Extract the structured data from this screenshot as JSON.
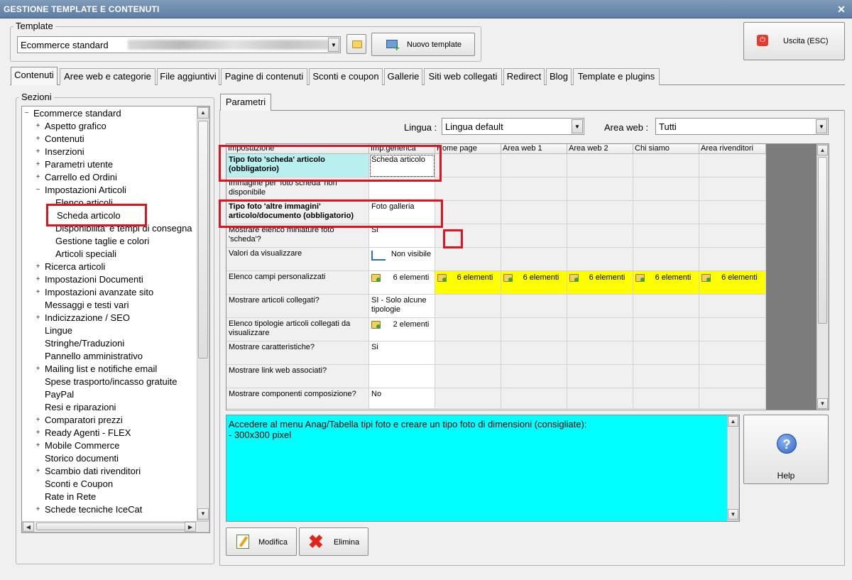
{
  "window": {
    "title": "GESTIONE TEMPLATE E CONTENUTI"
  },
  "template_group": {
    "label": "Template",
    "selected": "Ecommerce standard",
    "new_button": "Nuovo template"
  },
  "exit_button": "Uscita (ESC)",
  "tabs": [
    "Contenuti",
    "Aree web e categorie",
    "File aggiuntivi",
    "Pagine di contenuti",
    "Sconti e coupon",
    "Gallerie",
    "Siti web collegati",
    "Redirect",
    "Blog",
    "Template e plugins"
  ],
  "sections": {
    "label": "Sezioni",
    "tree": [
      {
        "label": "Ecommerce standard",
        "level": 0,
        "exp": "minus"
      },
      {
        "label": "Aspetto grafico",
        "level": 1,
        "exp": "plus"
      },
      {
        "label": "Contenuti",
        "level": 1,
        "exp": "plus"
      },
      {
        "label": "Inserzioni",
        "level": 1,
        "exp": "plus"
      },
      {
        "label": "Parametri utente",
        "level": 1,
        "exp": "plus"
      },
      {
        "label": "Carrello ed Ordini",
        "level": 1,
        "exp": "plus"
      },
      {
        "label": "Impostazioni Articoli",
        "level": 1,
        "exp": "minus"
      },
      {
        "label": "Elenco articoli",
        "level": 2,
        "exp": ""
      },
      {
        "label": "Scheda articolo",
        "level": 2,
        "exp": "",
        "selected": true
      },
      {
        "label": "Disponibilita' e tempi di consegna",
        "level": 2,
        "exp": ""
      },
      {
        "label": "Gestione taglie e colori",
        "level": 2,
        "exp": ""
      },
      {
        "label": "Articoli speciali",
        "level": 2,
        "exp": ""
      },
      {
        "label": "Ricerca articoli",
        "level": 1,
        "exp": "plus"
      },
      {
        "label": "Impostazioni Documenti",
        "level": 1,
        "exp": "plus"
      },
      {
        "label": "Impostazioni avanzate sito",
        "level": 1,
        "exp": "plus"
      },
      {
        "label": "Messaggi e testi vari",
        "level": 1,
        "exp": ""
      },
      {
        "label": "Indicizzazione / SEO",
        "level": 1,
        "exp": "plus"
      },
      {
        "label": "Lingue",
        "level": 1,
        "exp": ""
      },
      {
        "label": "Stringhe/Traduzioni",
        "level": 1,
        "exp": ""
      },
      {
        "label": "Pannello amministrativo",
        "level": 1,
        "exp": ""
      },
      {
        "label": "Mailing list e notifiche email",
        "level": 1,
        "exp": "plus"
      },
      {
        "label": "Spese trasporto/incasso gratuite",
        "level": 1,
        "exp": ""
      },
      {
        "label": "PayPal",
        "level": 1,
        "exp": ""
      },
      {
        "label": "Resi e riparazioni",
        "level": 1,
        "exp": ""
      },
      {
        "label": "Comparatori prezzi",
        "level": 1,
        "exp": "plus"
      },
      {
        "label": "Ready Agenti - FLEX",
        "level": 1,
        "exp": "plus"
      },
      {
        "label": "Mobile Commerce",
        "level": 1,
        "exp": "plus"
      },
      {
        "label": "Storico documenti",
        "level": 1,
        "exp": ""
      },
      {
        "label": "Scambio dati rivenditori",
        "level": 1,
        "exp": "plus"
      },
      {
        "label": "Sconti e Coupon",
        "level": 1,
        "exp": ""
      },
      {
        "label": "Rate in Rete",
        "level": 1,
        "exp": ""
      },
      {
        "label": "Schede tecniche IceCat",
        "level": 1,
        "exp": "plus"
      }
    ]
  },
  "params": {
    "tab": "Parametri",
    "lingua_label": "Lingua :",
    "lingua_value": "Lingua default",
    "area_label": "Area web :",
    "area_value": "Tutti",
    "columns": [
      "Impostazione",
      "Imp.generica",
      "Home page",
      "Area web 1",
      "Area web 2",
      "Chi siamo",
      "Area rivenditori"
    ],
    "rows": [
      {
        "setting": "Tipo foto 'scheda' articolo (obbligatorio)",
        "bold": true,
        "value": "Scheda articolo"
      },
      {
        "setting": "Immagine per 'foto scheda' non disponibile",
        "value": ""
      },
      {
        "setting": "Tipo foto 'altre immagini' articolo/documento (obbligatorio)",
        "bold": true,
        "value": "Foto galleria"
      },
      {
        "setting": "Mostrare elenco miniature foto 'scheda'?",
        "value": "Si"
      },
      {
        "setting": "Valori da visualizzare",
        "value": "Non visibile",
        "icon": "tree-icon"
      },
      {
        "setting": "Elenco campi personalizzati",
        "value": "6 elementi",
        "icon": "folder-icon",
        "areas": [
          "6 elementi",
          "6 elementi",
          "6 elementi",
          "6 elementi",
          "6 elementi"
        ]
      },
      {
        "setting": "Mostrare articoli collegati?",
        "value": "SI - Solo alcune tipologie"
      },
      {
        "setting": "Elenco tipologie articoli collegati da visualizzare",
        "value": "2 elementi",
        "icon": "folder-icon"
      },
      {
        "setting": "Mostrare caratteristiche?",
        "value": "Si"
      },
      {
        "setting": "Mostrare link web associati?",
        "value": ""
      },
      {
        "setting": "Mostrare componenti composizione?",
        "value": "No"
      }
    ],
    "description": "Accedere al menu Anag/Tabella tipi foto e creare un tipo foto di dimensioni (consigliate):\n- 300x300 pixel",
    "help_button": "Help",
    "modify_button": "Modifica",
    "delete_button": "Elimina"
  },
  "colors": {
    "highlight": "#ffff00",
    "description_bg": "#00ffff",
    "selected_cell": "#b8f0f0",
    "red_annotation": "#e0141e"
  }
}
